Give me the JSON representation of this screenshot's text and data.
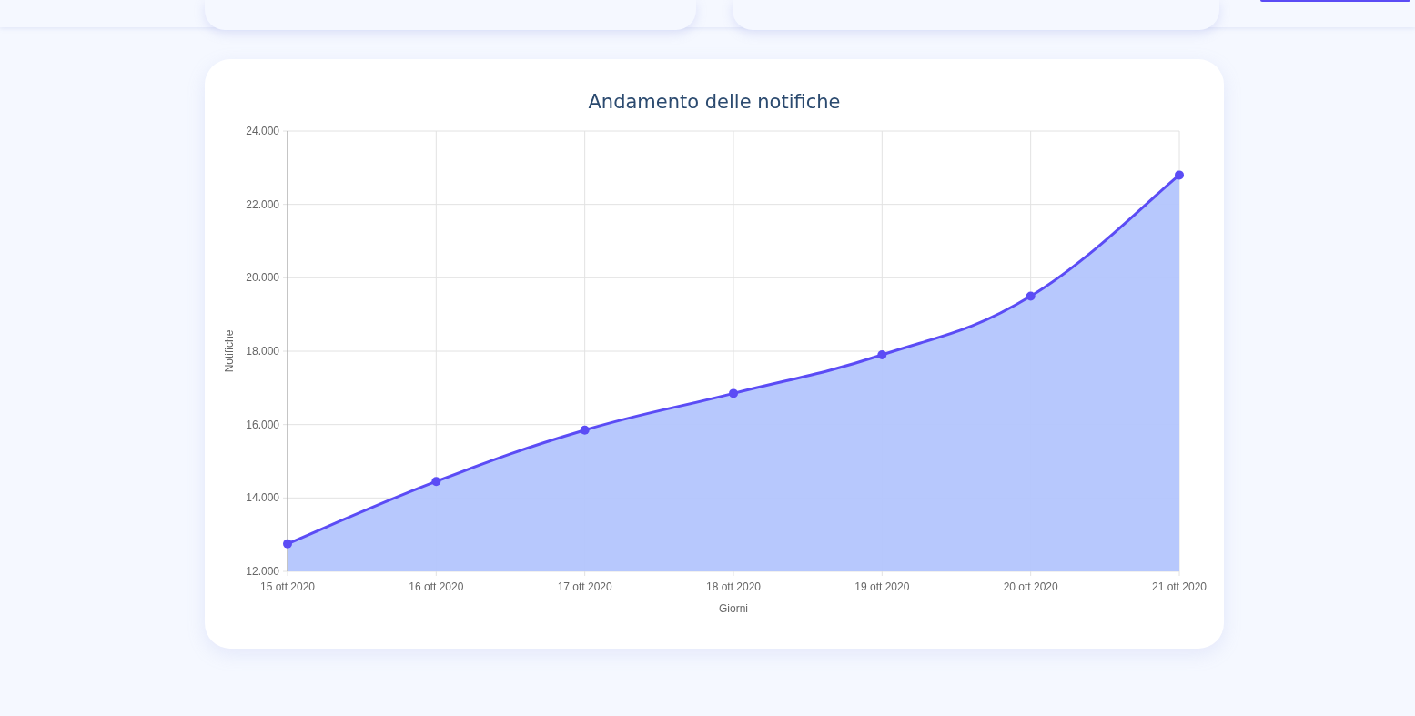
{
  "chart": {
    "title": "Andamento delle notifiche",
    "chart_data": {
      "type": "area",
      "xlabel": "Giorni",
      "ylabel": "Notifiche",
      "categories": [
        "15 ott 2020",
        "16 ott 2020",
        "17 ott 2020",
        "18 ott 2020",
        "19 ott 2020",
        "20 ott 2020",
        "21 ott 2020"
      ],
      "grid": true,
      "series": [
        {
          "color": "#5b4cf5",
          "values": [
            12750,
            14450,
            15850,
            16850,
            17900,
            19500,
            22800
          ]
        }
      ],
      "ylim": [
        12000,
        24000
      ],
      "yticks": [
        {
          "value": 12000,
          "label": "12.000"
        },
        {
          "value": 14000,
          "label": "14.000"
        },
        {
          "value": 16000,
          "label": "16.000"
        },
        {
          "value": 18000,
          "label": "18.000"
        },
        {
          "value": 20000,
          "label": "20.000"
        },
        {
          "value": 22000,
          "label": "22.000"
        },
        {
          "value": 24000,
          "label": "24.000"
        }
      ]
    }
  }
}
